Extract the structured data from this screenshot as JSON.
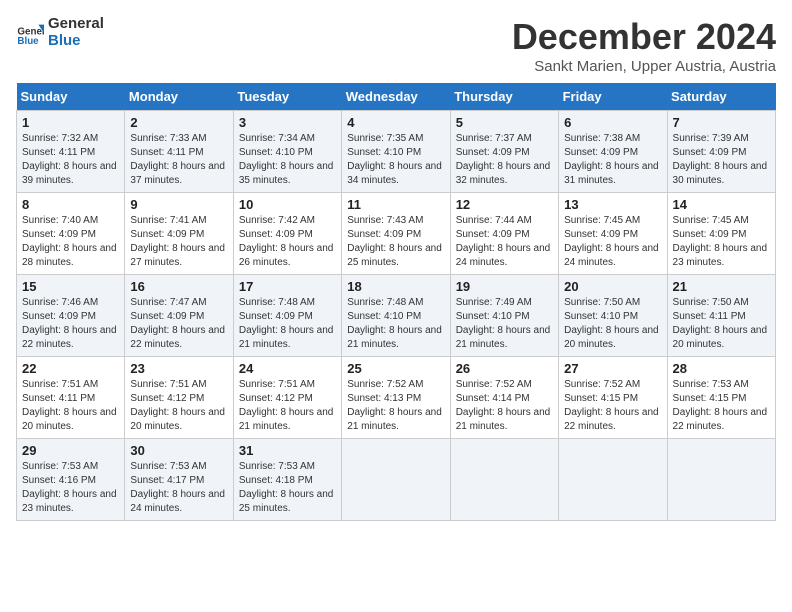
{
  "logo": {
    "line1": "General",
    "line2": "Blue"
  },
  "title": "December 2024",
  "subtitle": "Sankt Marien, Upper Austria, Austria",
  "days_of_week": [
    "Sunday",
    "Monday",
    "Tuesday",
    "Wednesday",
    "Thursday",
    "Friday",
    "Saturday"
  ],
  "weeks": [
    [
      {
        "day": "1",
        "sunrise": "7:32 AM",
        "sunset": "4:11 PM",
        "daylight": "8 hours and 39 minutes."
      },
      {
        "day": "2",
        "sunrise": "7:33 AM",
        "sunset": "4:11 PM",
        "daylight": "8 hours and 37 minutes."
      },
      {
        "day": "3",
        "sunrise": "7:34 AM",
        "sunset": "4:10 PM",
        "daylight": "8 hours and 35 minutes."
      },
      {
        "day": "4",
        "sunrise": "7:35 AM",
        "sunset": "4:10 PM",
        "daylight": "8 hours and 34 minutes."
      },
      {
        "day": "5",
        "sunrise": "7:37 AM",
        "sunset": "4:09 PM",
        "daylight": "8 hours and 32 minutes."
      },
      {
        "day": "6",
        "sunrise": "7:38 AM",
        "sunset": "4:09 PM",
        "daylight": "8 hours and 31 minutes."
      },
      {
        "day": "7",
        "sunrise": "7:39 AM",
        "sunset": "4:09 PM",
        "daylight": "8 hours and 30 minutes."
      }
    ],
    [
      {
        "day": "8",
        "sunrise": "7:40 AM",
        "sunset": "4:09 PM",
        "daylight": "8 hours and 28 minutes."
      },
      {
        "day": "9",
        "sunrise": "7:41 AM",
        "sunset": "4:09 PM",
        "daylight": "8 hours and 27 minutes."
      },
      {
        "day": "10",
        "sunrise": "7:42 AM",
        "sunset": "4:09 PM",
        "daylight": "8 hours and 26 minutes."
      },
      {
        "day": "11",
        "sunrise": "7:43 AM",
        "sunset": "4:09 PM",
        "daylight": "8 hours and 25 minutes."
      },
      {
        "day": "12",
        "sunrise": "7:44 AM",
        "sunset": "4:09 PM",
        "daylight": "8 hours and 24 minutes."
      },
      {
        "day": "13",
        "sunrise": "7:45 AM",
        "sunset": "4:09 PM",
        "daylight": "8 hours and 24 minutes."
      },
      {
        "day": "14",
        "sunrise": "7:45 AM",
        "sunset": "4:09 PM",
        "daylight": "8 hours and 23 minutes."
      }
    ],
    [
      {
        "day": "15",
        "sunrise": "7:46 AM",
        "sunset": "4:09 PM",
        "daylight": "8 hours and 22 minutes."
      },
      {
        "day": "16",
        "sunrise": "7:47 AM",
        "sunset": "4:09 PM",
        "daylight": "8 hours and 22 minutes."
      },
      {
        "day": "17",
        "sunrise": "7:48 AM",
        "sunset": "4:09 PM",
        "daylight": "8 hours and 21 minutes."
      },
      {
        "day": "18",
        "sunrise": "7:48 AM",
        "sunset": "4:10 PM",
        "daylight": "8 hours and 21 minutes."
      },
      {
        "day": "19",
        "sunrise": "7:49 AM",
        "sunset": "4:10 PM",
        "daylight": "8 hours and 21 minutes."
      },
      {
        "day": "20",
        "sunrise": "7:50 AM",
        "sunset": "4:10 PM",
        "daylight": "8 hours and 20 minutes."
      },
      {
        "day": "21",
        "sunrise": "7:50 AM",
        "sunset": "4:11 PM",
        "daylight": "8 hours and 20 minutes."
      }
    ],
    [
      {
        "day": "22",
        "sunrise": "7:51 AM",
        "sunset": "4:11 PM",
        "daylight": "8 hours and 20 minutes."
      },
      {
        "day": "23",
        "sunrise": "7:51 AM",
        "sunset": "4:12 PM",
        "daylight": "8 hours and 20 minutes."
      },
      {
        "day": "24",
        "sunrise": "7:51 AM",
        "sunset": "4:12 PM",
        "daylight": "8 hours and 21 minutes."
      },
      {
        "day": "25",
        "sunrise": "7:52 AM",
        "sunset": "4:13 PM",
        "daylight": "8 hours and 21 minutes."
      },
      {
        "day": "26",
        "sunrise": "7:52 AM",
        "sunset": "4:14 PM",
        "daylight": "8 hours and 21 minutes."
      },
      {
        "day": "27",
        "sunrise": "7:52 AM",
        "sunset": "4:15 PM",
        "daylight": "8 hours and 22 minutes."
      },
      {
        "day": "28",
        "sunrise": "7:53 AM",
        "sunset": "4:15 PM",
        "daylight": "8 hours and 22 minutes."
      }
    ],
    [
      {
        "day": "29",
        "sunrise": "7:53 AM",
        "sunset": "4:16 PM",
        "daylight": "8 hours and 23 minutes."
      },
      {
        "day": "30",
        "sunrise": "7:53 AM",
        "sunset": "4:17 PM",
        "daylight": "8 hours and 24 minutes."
      },
      {
        "day": "31",
        "sunrise": "7:53 AM",
        "sunset": "4:18 PM",
        "daylight": "8 hours and 25 minutes."
      },
      null,
      null,
      null,
      null
    ]
  ],
  "sunrise_label": "Sunrise:",
  "sunset_label": "Sunset:",
  "daylight_label": "Daylight:"
}
